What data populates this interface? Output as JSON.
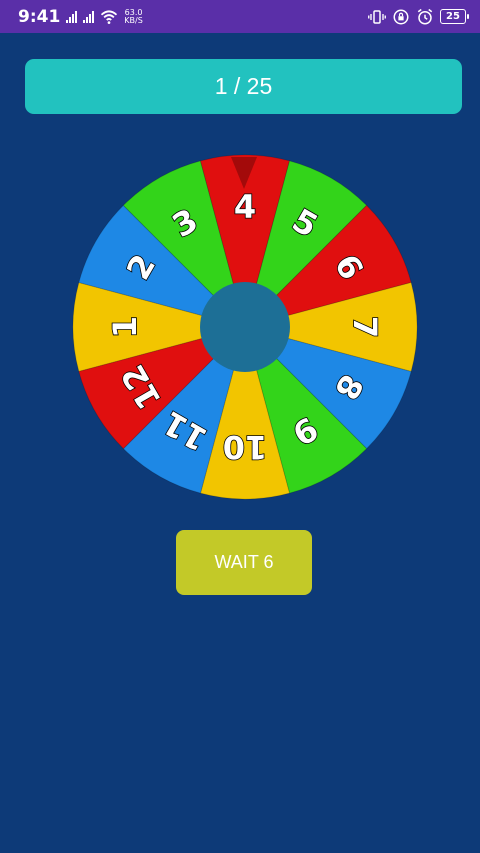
{
  "status_bar": {
    "time": "9:41",
    "net_speed_value": "63.0",
    "net_speed_unit": "KB/S",
    "battery": "25",
    "icons": [
      "signal-icon",
      "signal-icon",
      "wifi-icon",
      "vibrate-icon",
      "lock-rotation-icon",
      "alarm-icon",
      "battery-icon"
    ]
  },
  "progress": {
    "label": "1 / 25",
    "current": 1,
    "total": 25
  },
  "wheel": {
    "segments": [
      {
        "label": "1",
        "color": "#f2c500"
      },
      {
        "label": "2",
        "color": "#1e88e5"
      },
      {
        "label": "3",
        "color": "#33d41a"
      },
      {
        "label": "4",
        "color": "#e00f0f"
      },
      {
        "label": "5",
        "color": "#33d41a"
      },
      {
        "label": "6",
        "color": "#e00f0f"
      },
      {
        "label": "7",
        "color": "#f2c500"
      },
      {
        "label": "8",
        "color": "#1e88e5"
      },
      {
        "label": "9",
        "color": "#33d41a"
      },
      {
        "label": "10",
        "color": "#f2c500"
      },
      {
        "label": "11",
        "color": "#1e88e5"
      },
      {
        "label": "12",
        "color": "#e00f0f"
      }
    ],
    "hub_color": "#1d6f96",
    "pointer_color": "#a30a0a"
  },
  "action_button": {
    "label": "WAIT 6"
  },
  "colors": {
    "background": "#0d3a78",
    "status_bar": "#5a2fa8",
    "counter_bar": "#22c2bf",
    "button": "#c3c928"
  }
}
